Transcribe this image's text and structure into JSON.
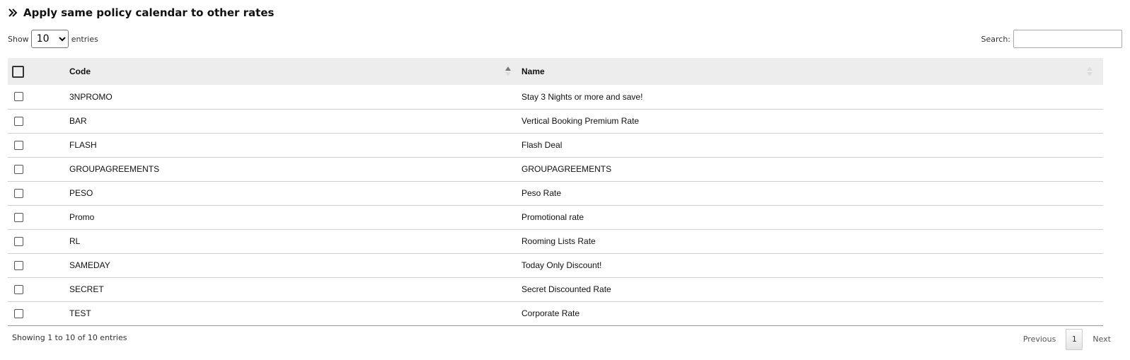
{
  "header": {
    "title": "Apply same policy calendar to other rates",
    "icon": "double-chevron-right-icon"
  },
  "length": {
    "label_before": "Show",
    "value": "10",
    "label_after": "entries"
  },
  "search": {
    "label": "Search:",
    "value": "",
    "placeholder": ""
  },
  "table": {
    "columns": [
      "Code",
      "Name"
    ],
    "rows": [
      {
        "code": "3NPROMO",
        "name": "Stay 3 Nights or more and save!"
      },
      {
        "code": "BAR",
        "name": "Vertical Booking Premium Rate"
      },
      {
        "code": "FLASH",
        "name": "Flash Deal"
      },
      {
        "code": "GROUPAGREEMENTS",
        "name": "GROUPAGREEMENTS"
      },
      {
        "code": "PESO",
        "name": "Peso Rate"
      },
      {
        "code": "Promo",
        "name": "Promotional rate"
      },
      {
        "code": "RL",
        "name": "Rooming Lists Rate"
      },
      {
        "code": "SAMEDAY",
        "name": "Today Only Discount!"
      },
      {
        "code": "SECRET",
        "name": "Secret Discounted Rate"
      },
      {
        "code": "TEST",
        "name": "Corporate Rate"
      }
    ]
  },
  "footer": {
    "info": "Showing 1 to 10 of 10 entries",
    "previous": "Previous",
    "current_page": "1",
    "next": "Next"
  }
}
